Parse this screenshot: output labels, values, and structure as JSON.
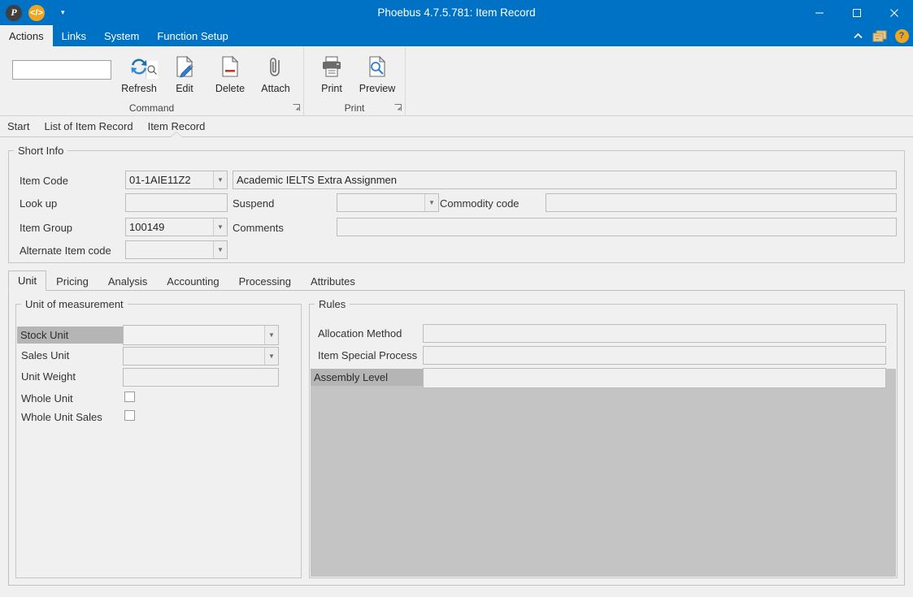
{
  "window": {
    "title": "Phoebus 4.7.5.781: Item Record",
    "accent_color": "#0072c6",
    "quick_access": [
      {
        "name": "phoebus-logo",
        "glyph": "P"
      },
      {
        "name": "code-icon",
        "glyph": "</>"
      }
    ],
    "qat_overflow_glyph": "▾",
    "controls": {
      "minimize": "—",
      "maximize": "☐",
      "close": "✕"
    }
  },
  "menubar": {
    "items": [
      {
        "label": "Actions",
        "active": true
      },
      {
        "label": "Links",
        "active": false
      },
      {
        "label": "System",
        "active": false
      },
      {
        "label": "Function Setup",
        "active": false
      }
    ],
    "right": {
      "collapse_label": "^",
      "windows_label": "windows-icon",
      "help_label": "?"
    }
  },
  "ribbon": {
    "search": {
      "value": "",
      "placeholder": ""
    },
    "groups": [
      {
        "name": "Command",
        "label": "Command",
        "launcher": "◪",
        "buttons": [
          {
            "label": "Refresh",
            "icon": "refresh-icon"
          },
          {
            "label": "Edit",
            "icon": "edit-icon"
          },
          {
            "label": "Delete",
            "icon": "delete-icon"
          },
          {
            "label": "Attach",
            "icon": "attach-icon"
          }
        ]
      },
      {
        "name": "Print",
        "label": "Print",
        "launcher": "◪",
        "buttons": [
          {
            "label": "Print",
            "icon": "printer-icon"
          },
          {
            "label": "Preview",
            "icon": "preview-icon"
          }
        ]
      }
    ]
  },
  "breadcrumbs": [
    {
      "label": "Start",
      "active": false
    },
    {
      "label": "List of Item Record",
      "active": false
    },
    {
      "label": "Item Record",
      "active": true
    }
  ],
  "short_info": {
    "legend": "Short Info",
    "item_code_label": "Item Code",
    "item_code_value": "01-1AIE11Z2",
    "description_value": "Academic IELTS Extra Assignmen",
    "look_up_label": "Look up",
    "look_up_value": "",
    "suspend_label": "Suspend",
    "suspend_value": "",
    "commodity_code_label": "Commodity code",
    "commodity_code_value": "",
    "item_group_label": "Item Group",
    "item_group_value": "100149",
    "comments_label": "Comments",
    "comments_value": "",
    "alternate_item_code_label": "Alternate Item code",
    "alternate_item_code_value": ""
  },
  "tabs": [
    {
      "label": "Unit",
      "active": true
    },
    {
      "label": "Pricing",
      "active": false
    },
    {
      "label": "Analysis",
      "active": false
    },
    {
      "label": "Accounting",
      "active": false
    },
    {
      "label": "Processing",
      "active": false
    },
    {
      "label": "Attributes",
      "active": false
    }
  ],
  "unit_panel": {
    "uom": {
      "legend": "Unit of measurement",
      "stock_unit_label": "Stock Unit",
      "stock_unit_value": "",
      "sales_unit_label": "Sales Unit",
      "sales_unit_value": "",
      "unit_weight_label": "Unit Weight",
      "unit_weight_value": "",
      "whole_unit_label": "Whole Unit",
      "whole_unit_checked": false,
      "whole_unit_sales_label": "Whole Unit Sales",
      "whole_unit_sales_checked": false
    },
    "rules": {
      "legend": "Rules",
      "allocation_method_label": "Allocation Method",
      "allocation_method_value": "",
      "item_special_process_label": "Item Special Process",
      "item_special_process_value": "",
      "assembly_level_label": "Assembly Level",
      "assembly_level_value": ""
    }
  }
}
